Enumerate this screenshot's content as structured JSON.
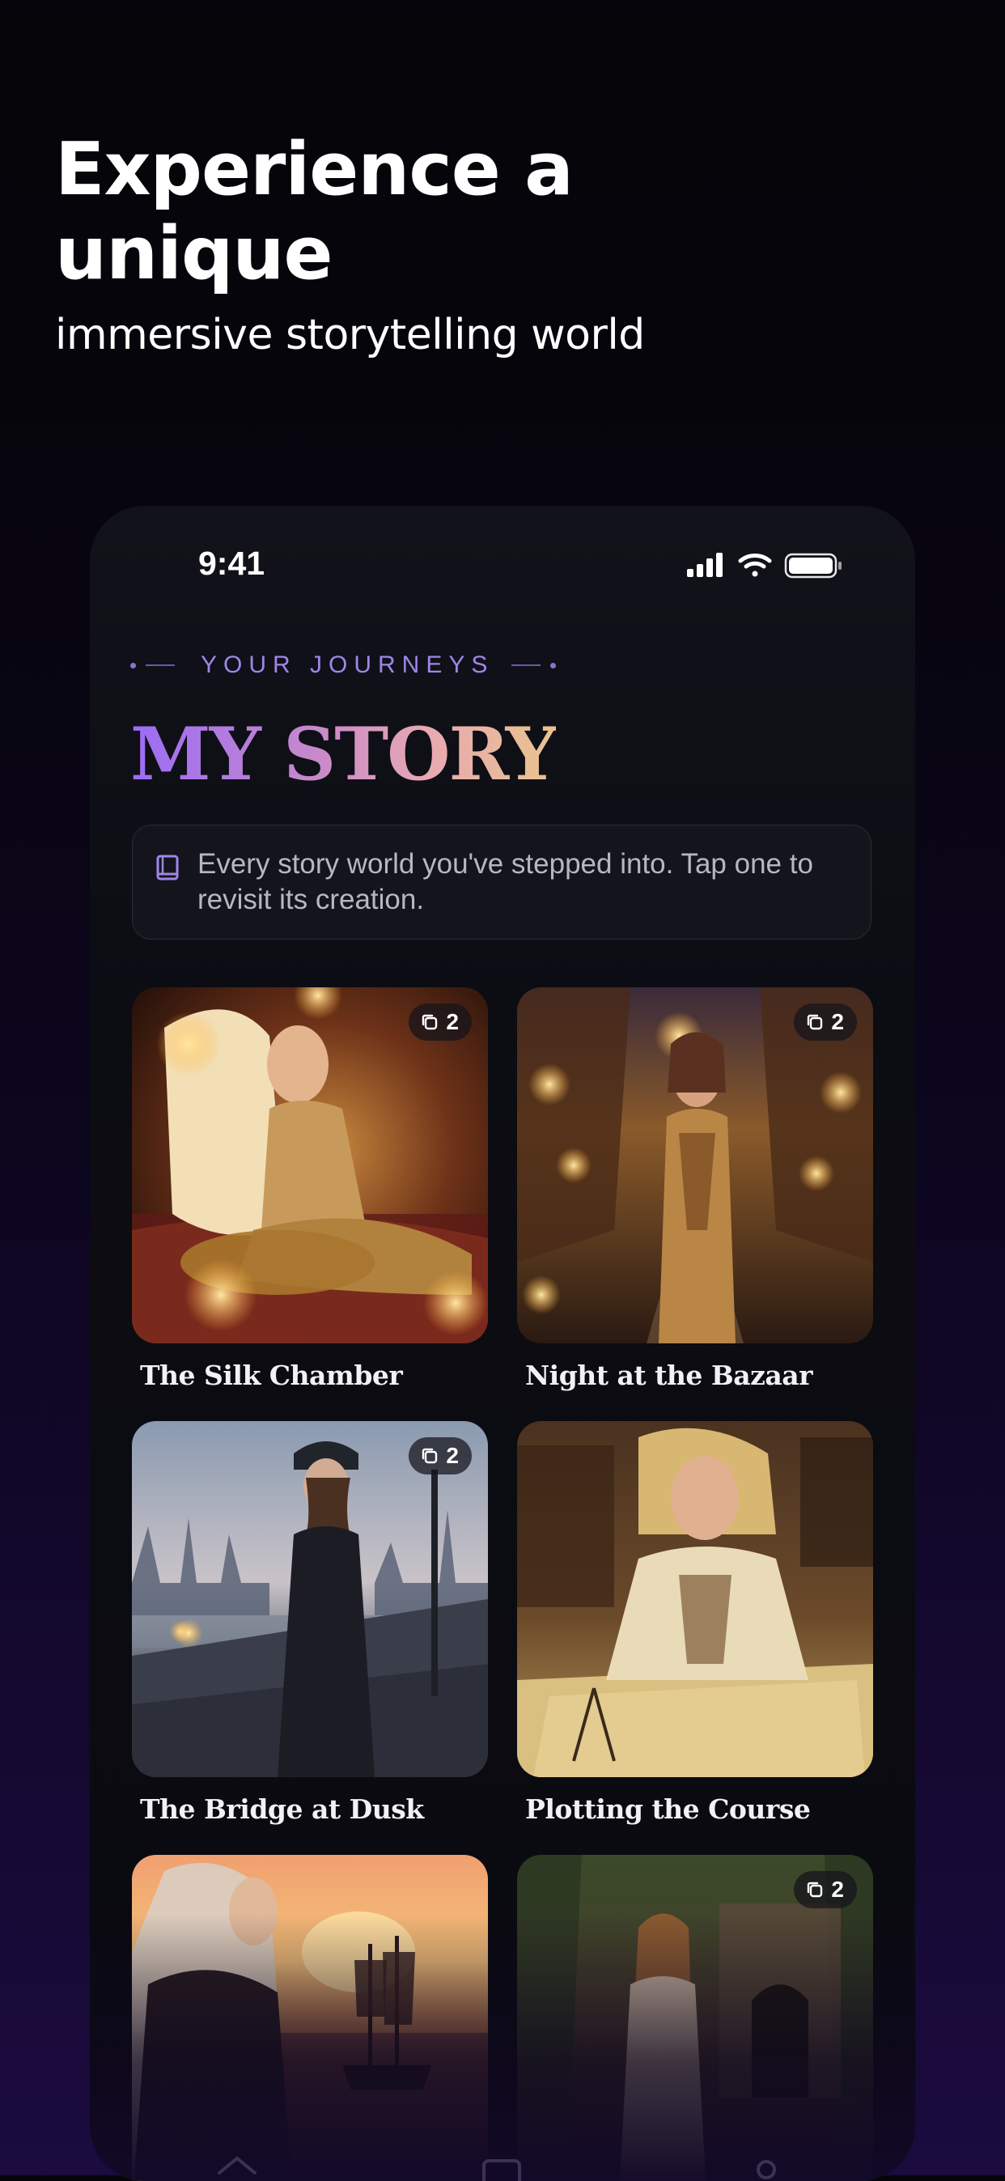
{
  "promo": {
    "headline": "Experience a\nunique",
    "subline": "immersive storytelling world"
  },
  "status_bar": {
    "time": "9:41",
    "icons": [
      "cellular-signal-icon",
      "wifi-icon",
      "battery-icon"
    ]
  },
  "header": {
    "eyebrow": "YOUR JOURNEYS",
    "title": "MY STORY",
    "info_icon": "book-icon",
    "info_text": "Every story world you've stepped into. Tap one to revisit its creation."
  },
  "stories": [
    {
      "title": "The Silk Chamber",
      "count": "2",
      "scene": "silk-chamber"
    },
    {
      "title": "Night at the Bazaar",
      "count": "2",
      "scene": "bazaar"
    },
    {
      "title": "The Bridge at Dusk",
      "count": "2",
      "scene": "bridge"
    },
    {
      "title": "Plotting the Course",
      "count": "",
      "scene": "map-room"
    },
    {
      "title": "",
      "count": "",
      "scene": "sunset-ship"
    },
    {
      "title": "",
      "count": "2",
      "scene": "jungle-ruins"
    }
  ],
  "tab_bar": {
    "icons": [
      "home-icon",
      "gallery-icon",
      "profile-icon"
    ]
  },
  "colors": {
    "accent_purple": "#9e86e8",
    "title_gradient": [
      "#9b6cf5",
      "#e8a9b2",
      "#e9c48d"
    ],
    "background": "#07050d"
  }
}
